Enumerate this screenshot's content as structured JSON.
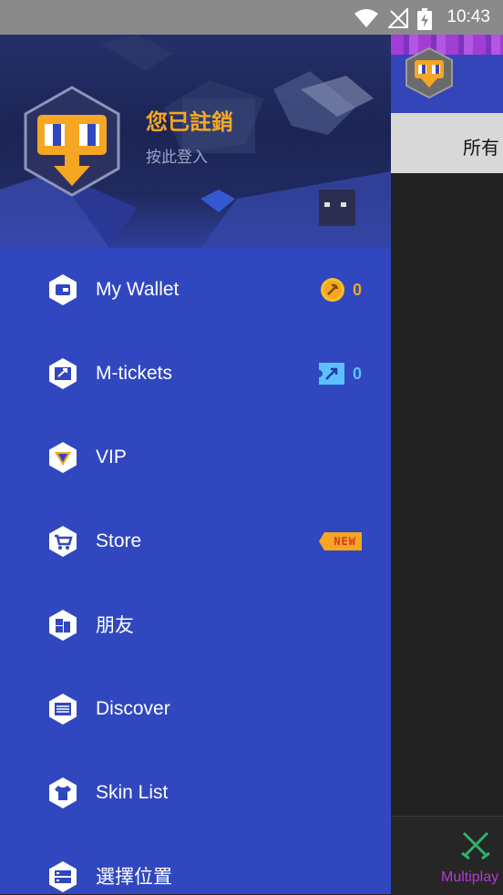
{
  "status_bar": {
    "time": "10:43"
  },
  "background_app": {
    "tab_label": "所有",
    "bottom_nav_label": "Multiplay"
  },
  "drawer": {
    "profile": {
      "name": "您已註銷",
      "subtitle": "按此登入"
    },
    "menu": [
      {
        "label": "My Wallet",
        "icon": "wallet-icon",
        "value": "0"
      },
      {
        "label": "M-tickets",
        "icon": "ticket-icon",
        "value": "0"
      },
      {
        "label": "VIP",
        "icon": "vip-icon"
      },
      {
        "label": "Store",
        "icon": "cart-icon",
        "badge": "NEW"
      },
      {
        "label": "朋友",
        "icon": "friends-icon"
      },
      {
        "label": "Discover",
        "icon": "news-icon"
      },
      {
        "label": "Skin List",
        "icon": "shirt-icon"
      },
      {
        "label": "選擇位置",
        "icon": "server-icon"
      }
    ]
  },
  "colors": {
    "drawer_bg": "#3047c0",
    "accent_orange": "#f5a623",
    "ticket_blue": "#5cc0ff",
    "status_bar": "#8a8a8a",
    "multiplayer_purple": "#b33ad6"
  }
}
